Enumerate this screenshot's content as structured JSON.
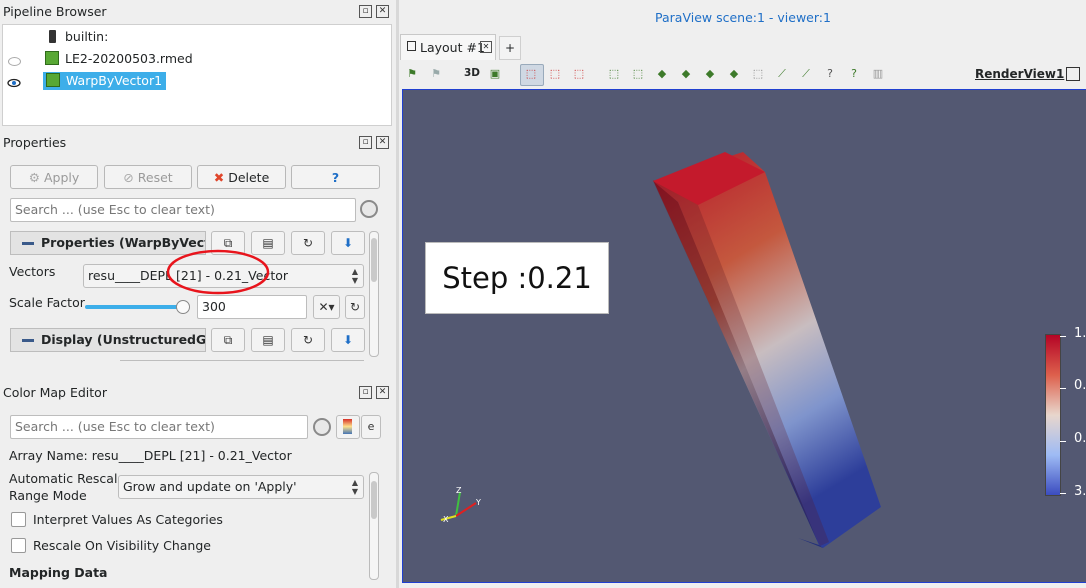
{
  "pipeline": {
    "title": "Pipeline Browser",
    "items": [
      {
        "label": "builtin:"
      },
      {
        "label": "LE2-20200503.rmed"
      },
      {
        "label": "WarpByVector1"
      }
    ]
  },
  "properties": {
    "title": "Properties",
    "apply_label": "Apply",
    "reset_label": "Reset",
    "delete_label": "Delete",
    "help_label": "?",
    "search_placeholder": "Search ... (use Esc to clear text)",
    "section1": "Properties (WarpByVector",
    "vectors_label": "Vectors",
    "vectors_value": "resu____DEPL [21] - 0.21_Vector",
    "scale_label": "Scale Factor",
    "scale_value": "300",
    "section2": "Display (UnstructuredGrid"
  },
  "colormap": {
    "title": "Color Map Editor",
    "search_placeholder": "Search ... (use Esc to clear text)",
    "array_name": "Array Name: resu____DEPL [21] - 0.21_Vector",
    "rescale_label_1": "Automatic Rescale",
    "rescale_label_2": "Range Mode",
    "rescale_value": "Grow and update on 'Apply'",
    "interpret_label": "Interpret Values As Categories",
    "rescale_vis_label": "Rescale On Visibility Change",
    "mapping_label": "Mapping Data"
  },
  "view": {
    "header": "ParaView scene:1 - viewer:1",
    "tab_label": "Layout #1",
    "add_tab": "+",
    "mode_3d": "3D",
    "render_view": "RenderView1",
    "step_text": "Step :0.21",
    "legend_ticks": [
      "1.",
      "0.",
      "0.",
      "3."
    ],
    "axes": {
      "x": "X",
      "y": "Y",
      "z": "Z"
    }
  },
  "colors": {
    "selection": "#3daee9",
    "viewport_bg": "#535872",
    "accent_blue": "#1f6fc7",
    "annotation_red": "#e8141c"
  }
}
